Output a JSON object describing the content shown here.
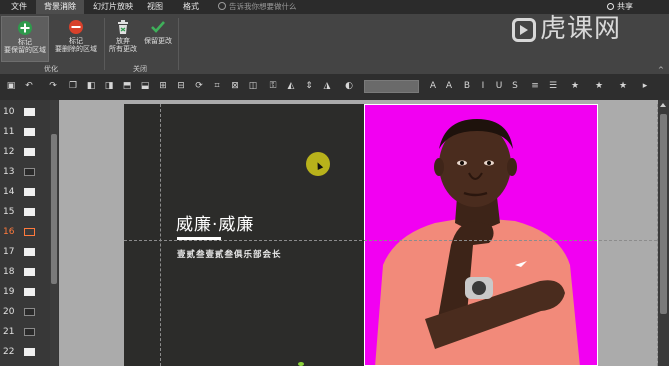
{
  "menu": {
    "tabs": [
      {
        "label": "文件",
        "active": false
      },
      {
        "label": "背景消除",
        "active": true
      },
      {
        "label": "幻灯片放映",
        "active": false
      },
      {
        "label": "视图",
        "active": false
      },
      {
        "label": "格式",
        "active": false
      }
    ],
    "tellme": "告诉我你想要做什么",
    "share": "共享"
  },
  "ribbon": {
    "mark_keep_label": "标记\n要保留的区域",
    "mark_remove_label": "标记\n要删除的区域",
    "discard_label": "放弃\n所有更改",
    "keep_changes_label": "保留更改",
    "group_optimize": "优化",
    "group_close": "关闭"
  },
  "logo": {
    "text": "虎课网"
  },
  "slides": {
    "numbers": [
      "10",
      "11",
      "12",
      "13",
      "14",
      "15",
      "16",
      "17",
      "18",
      "19",
      "20",
      "21",
      "22"
    ],
    "active_number": "16"
  },
  "slide": {
    "title": "威廉·威廉",
    "subtitle": "壹贰叁壹贰叁俱乐部会长"
  },
  "colors": {
    "photo_background": "#f200f2",
    "active_slide": "#ff7a3d",
    "cursor_highlight": "#c8c11a"
  }
}
